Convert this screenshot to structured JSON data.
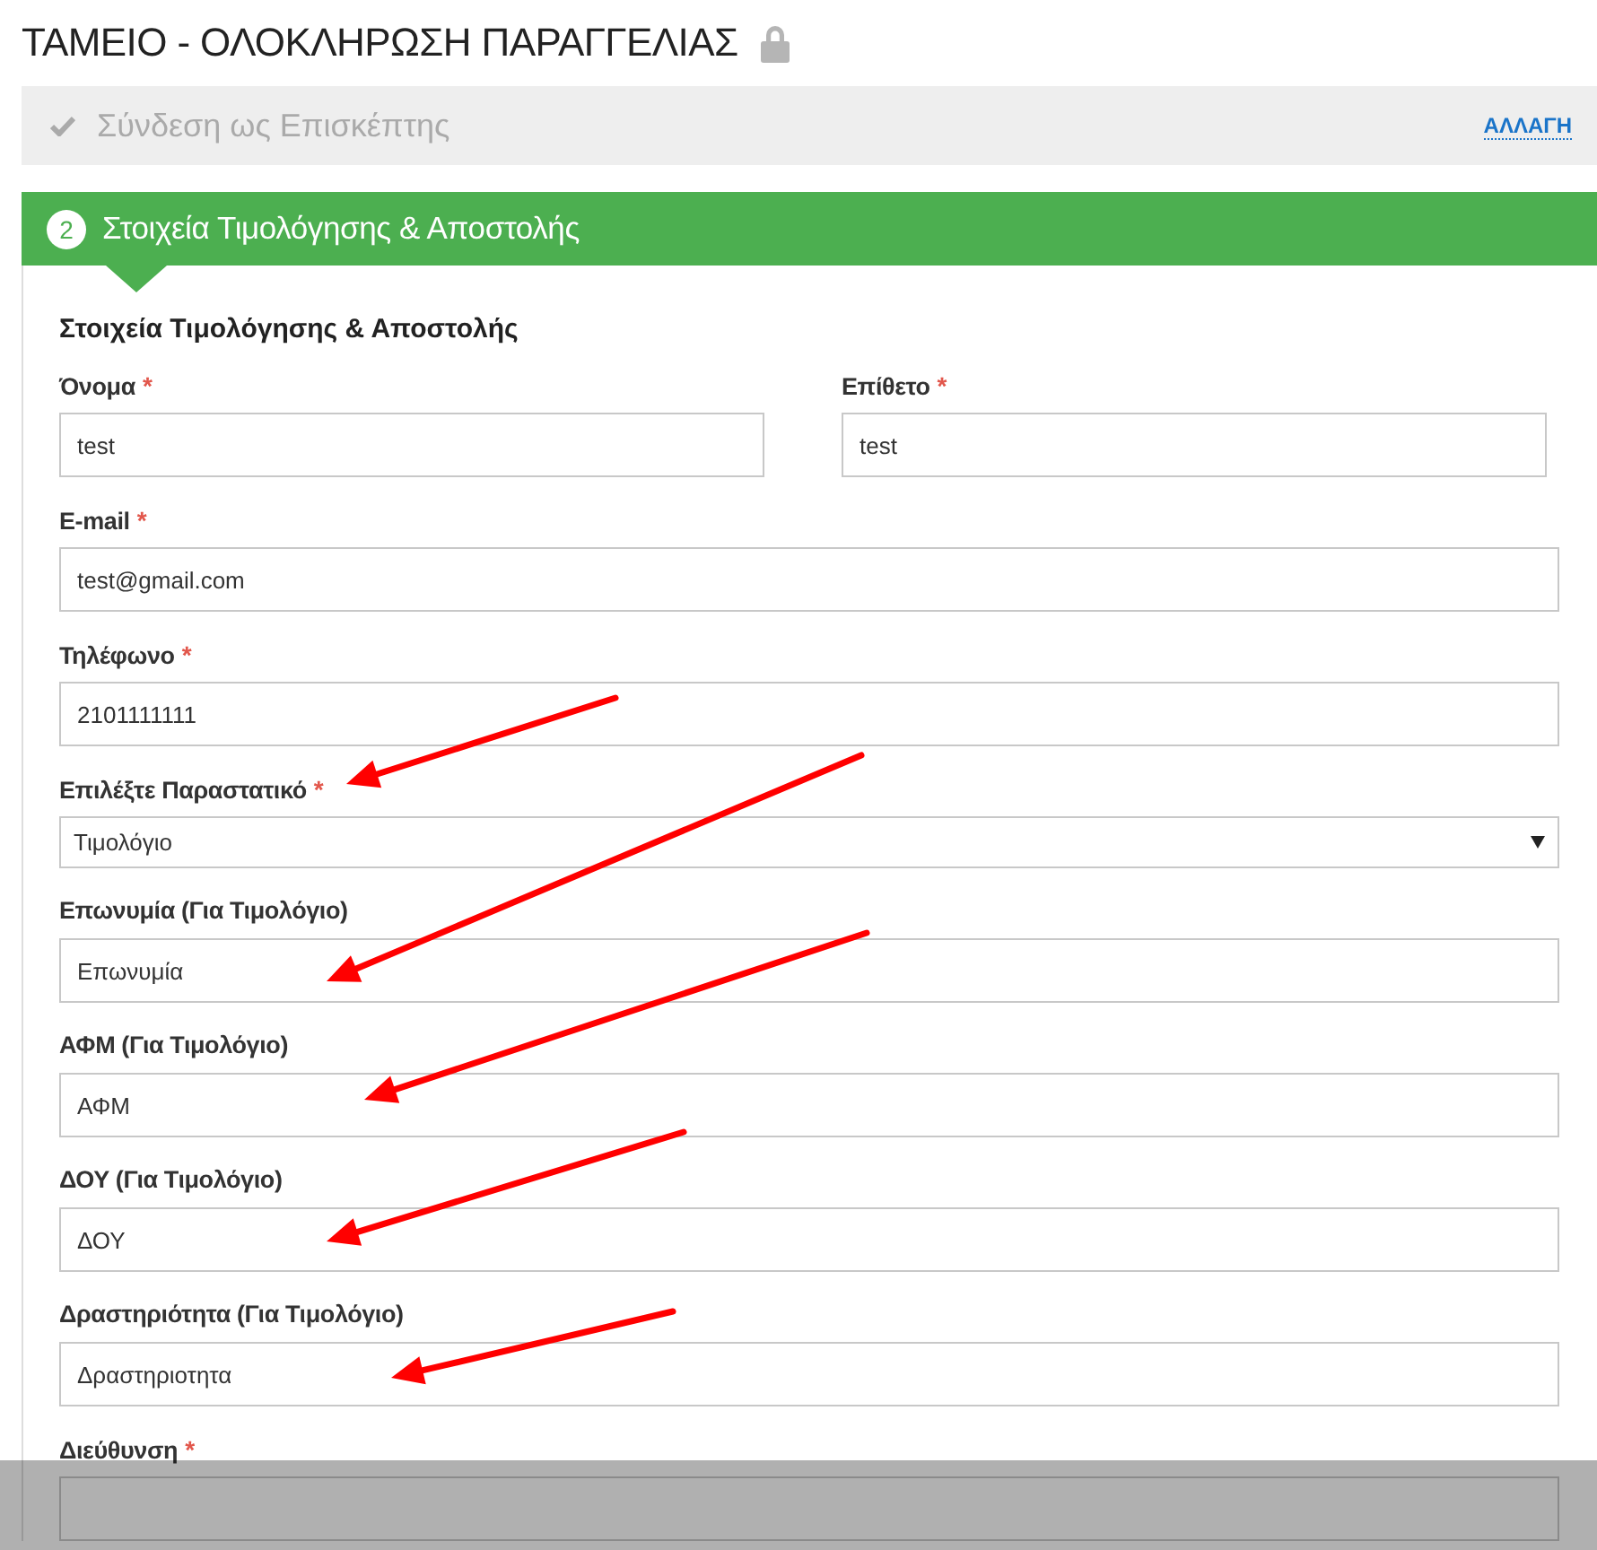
{
  "page_title": "ΤΑΜΕΙΟ - ΟΛΟΚΛΗΡΩΣΗ ΠΑΡΑΓΓΕΛΙΑΣ",
  "login_step": {
    "label": "Σύνδεση ως Επισκέπτης",
    "done": true,
    "action": "ΑΛΛΑΓΗ"
  },
  "billing_step": {
    "number": "2",
    "title": "Στοιχεία Τιμολόγησης & Αποστολής",
    "expanded": true,
    "heading": "Στοιχεία Τιμολόγησης & Αποστολής",
    "rows": [
      [
        {
          "kind": "text",
          "label": "Όνομα",
          "required_mark": "*",
          "value": "test",
          "arrow": false
        },
        {
          "kind": "text",
          "label": "Επίθετο",
          "required_mark": "*",
          "value": "test",
          "arrow": false
        }
      ],
      [
        {
          "kind": "text",
          "label": "E-mail",
          "required_mark": "*",
          "value": "test@gmail.com",
          "arrow": false
        }
      ],
      [
        {
          "kind": "text",
          "label": "Τηλέφωνο",
          "required_mark": "*",
          "value": "2101111111",
          "arrow": false
        }
      ],
      [
        {
          "kind": "select",
          "label": "Επιλέξτε Παραστατικό",
          "required_mark": "*",
          "value": "Τιμολόγιο",
          "arrow": true
        }
      ],
      [
        {
          "kind": "text",
          "label": "Επωνυμία (Για Τιμολόγιο)",
          "value": "Επωνυμία",
          "arrow": true
        }
      ],
      [
        {
          "kind": "text",
          "label": "ΑΦΜ (Για Τιμολόγιο)",
          "value": "ΑΦΜ",
          "arrow": true
        }
      ],
      [
        {
          "kind": "text",
          "label": "ΔΟΥ (Για Τιμολόγιο)",
          "value": "ΔΟΥ",
          "arrow": true
        }
      ],
      [
        {
          "kind": "text",
          "label": "Δραστηριότητα (Για Τιμολόγιο)",
          "value": "Δραστηριοτητα",
          "arrow": true
        }
      ],
      [
        {
          "kind": "text",
          "label": "Διεύθυνση",
          "required_mark": "*",
          "arrow": false
        }
      ]
    ]
  },
  "bottom_overlay": {
    "visible": true
  }
}
